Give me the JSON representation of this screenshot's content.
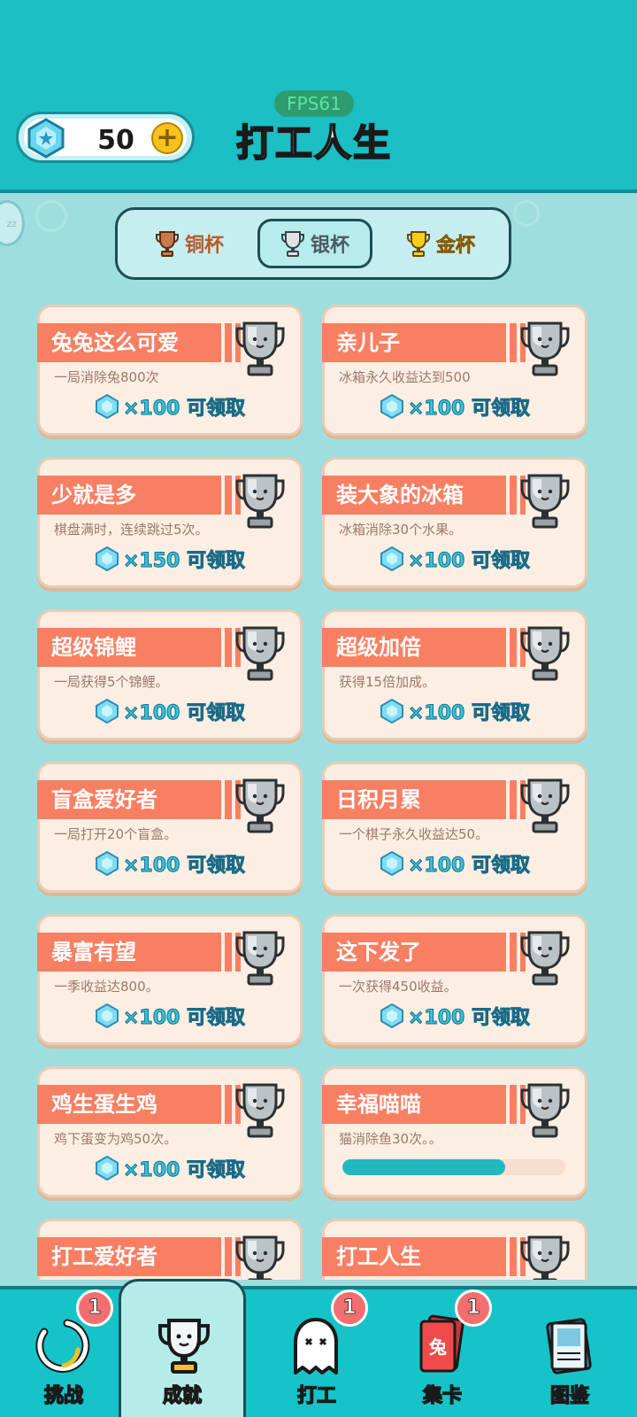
{
  "header": {
    "gem_count": "50",
    "fps": "FPS61",
    "title": "打工人生"
  },
  "side_bubble": "zz",
  "tabs": [
    {
      "label": "铜杯",
      "icon": "bronze-cup-icon",
      "active": false
    },
    {
      "label": "银杯",
      "icon": "silver-cup-icon",
      "active": true
    },
    {
      "label": "金杯",
      "icon": "gold-cup-icon",
      "active": false
    }
  ],
  "achievements": [
    {
      "title": "兔兔这么可爱",
      "desc": "一局消除兔800次",
      "reward": "×100 可领取"
    },
    {
      "title": "亲儿子",
      "desc": "冰箱永久收益达到500",
      "reward": "×100 可领取"
    },
    {
      "title": "少就是多",
      "desc": "棋盘满时，连续跳过5次。",
      "reward": "×150 可领取"
    },
    {
      "title": "装大象的冰箱",
      "desc": "冰箱消除30个水果。",
      "reward": "×100 可领取"
    },
    {
      "title": "超级锦鲤",
      "desc": "一局获得5个锦鲤。",
      "reward": "×100 可领取"
    },
    {
      "title": "超级加倍",
      "desc": "获得15倍加成。",
      "reward": "×100 可领取"
    },
    {
      "title": "盲盒爱好者",
      "desc": "一局打开20个盲盒。",
      "reward": "×100 可领取"
    },
    {
      "title": "日积月累",
      "desc": "一个棋子永久收益达50。",
      "reward": "×100 可领取"
    },
    {
      "title": "暴富有望",
      "desc": "一季收益达800。",
      "reward": "×100 可领取"
    },
    {
      "title": "这下发了",
      "desc": "一次获得450收益。",
      "reward": "×100 可领取"
    },
    {
      "title": "鸡生蛋生鸡",
      "desc": "鸡下蛋变为鸡50次。",
      "reward": "×100 可领取"
    },
    {
      "title": "幸福喵喵",
      "desc": "猫消除鱼30次。。",
      "reward": "",
      "progress": 0.73
    },
    {
      "title": "打工爱好者",
      "desc": "",
      "reward": ""
    },
    {
      "title": "打工人生",
      "desc": "",
      "reward": ""
    }
  ],
  "nav": [
    {
      "label": "挑战",
      "icon": "challenge-ring-icon",
      "badge": "1",
      "active": false
    },
    {
      "label": "成就",
      "icon": "trophy-icon",
      "badge": "",
      "active": true
    },
    {
      "label": "打工",
      "icon": "ghost-icon",
      "badge": "1",
      "active": false
    },
    {
      "label": "集卡",
      "icon": "rabbit-card-icon",
      "badge": "1",
      "active": false,
      "card_text": "兔"
    },
    {
      "label": "图鉴",
      "icon": "book-icon",
      "badge": "",
      "active": false
    }
  ],
  "colors": {
    "header": "#1bbfc4",
    "background": "#9fdede",
    "ribbon": "#f97f63",
    "card": "#fdeee3",
    "progress": "#21b8c0"
  }
}
